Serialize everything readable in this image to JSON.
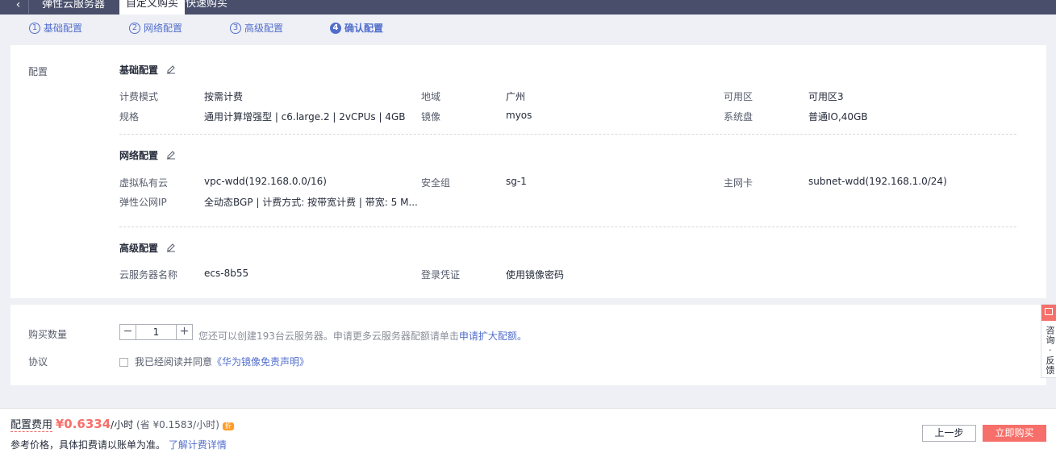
{
  "topbar": {
    "back_icon": "chevron-left-icon",
    "title": "弹性云服务器",
    "tabs": [
      {
        "label": "自定义购买"
      },
      {
        "label": "快速购买"
      }
    ]
  },
  "steps": [
    {
      "num": "1",
      "label": "基础配置"
    },
    {
      "num": "2",
      "label": "网络配置"
    },
    {
      "num": "3",
      "label": "高级配置"
    },
    {
      "num": "4",
      "label": "确认配置"
    }
  ],
  "config": {
    "label": "配置",
    "basic": {
      "title": "基础配置",
      "rows": [
        {
          "k1": "计费模式",
          "v1": "按需计费",
          "k2": "地域",
          "v2": "广州",
          "k3": "可用区",
          "v3": "可用区3"
        },
        {
          "k1": "规格",
          "v1": "通用计算增强型 | c6.large.2 | 2vCPUs | 4GB",
          "k2": "镜像",
          "v2": "myos",
          "k3": "系统盘",
          "v3": "普通IO,40GB"
        }
      ]
    },
    "network": {
      "title": "网络配置",
      "rows": [
        {
          "k1": "虚拟私有云",
          "v1": "vpc-wdd(192.168.0.0/16)",
          "k2": "安全组",
          "v2": "sg-1",
          "k3": "主网卡",
          "v3": "subnet-wdd(192.168.1.0/24)"
        },
        {
          "k1": "弹性公网IP",
          "v1": "全动态BGP | 计费方式: 按带宽计费 | 带宽: 5 M..."
        }
      ]
    },
    "advanced": {
      "title": "高级配置",
      "rows": [
        {
          "k1": "云服务器名称",
          "v1": "ecs-8b55",
          "k2": "登录凭证",
          "v2": "使用镜像密码"
        }
      ]
    }
  },
  "purchase": {
    "qty_label": "购买数量",
    "qty_value": "1",
    "qty_hint": "您还可以创建193台云服务器。申请更多云服务器配额请单击",
    "qty_link": "申请扩大配额",
    "qty_hint_end": "。",
    "agreement_label": "协议",
    "agreement_text": "我已经阅读并同意",
    "agreement_link": "《华为镜像免责声明》"
  },
  "side": {
    "text": "咨询 · 反馈",
    "icon": "feedback-icon"
  },
  "footer": {
    "price_label": "配置费用",
    "price": "¥0.6334",
    "unit": "/小时",
    "saving": "(省 ¥0.1583/小时)",
    "badge": "折",
    "note": "参考价格，具体扣费请以账单为准。",
    "note_link": "了解计费详情",
    "prev_label": "上一步",
    "buy_label": "立即购买"
  },
  "colors": {
    "accent": "#526ecc",
    "buy": "#f66f6a",
    "topbar": "#494f6b"
  }
}
